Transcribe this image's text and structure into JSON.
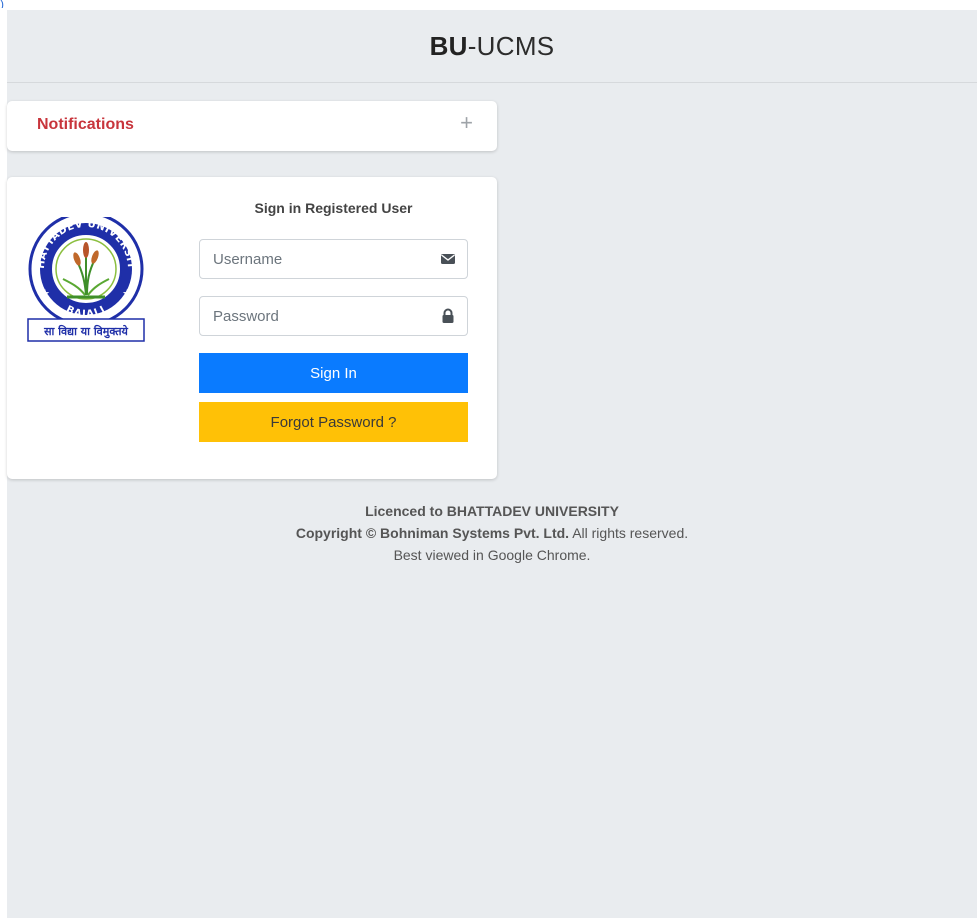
{
  "header": {
    "brand_bold": "BU",
    "brand_light": "-UCMS"
  },
  "notifications": {
    "title": "Notifications",
    "toggle_symbol": "+"
  },
  "login": {
    "title": "Sign in Registered User",
    "logo": {
      "ring_text": "BHATTADEV UNIVERSITY",
      "place": "BAJALI",
      "motto": "सा विद्या या विमुक्तये"
    },
    "username_placeholder": "Username",
    "password_placeholder": "Password",
    "signin_label": "Sign In",
    "forgot_label": "Forgot Password ?"
  },
  "footer": {
    "licence": "Licenced to BHATTADEV UNIVERSITY",
    "copyright_prefix": "Copyright © Bohniman Systems Pvt. Ltd.",
    "copyright_suffix": " All rights reserved.",
    "browser_note": "Best viewed in Google Chrome."
  },
  "colors": {
    "page_bg": "#e9ecef",
    "notification_title": "#c8353c",
    "signin_button": "#0a7bff",
    "forgot_button": "#ffc106",
    "logo_blue": "#1f2fa8"
  }
}
